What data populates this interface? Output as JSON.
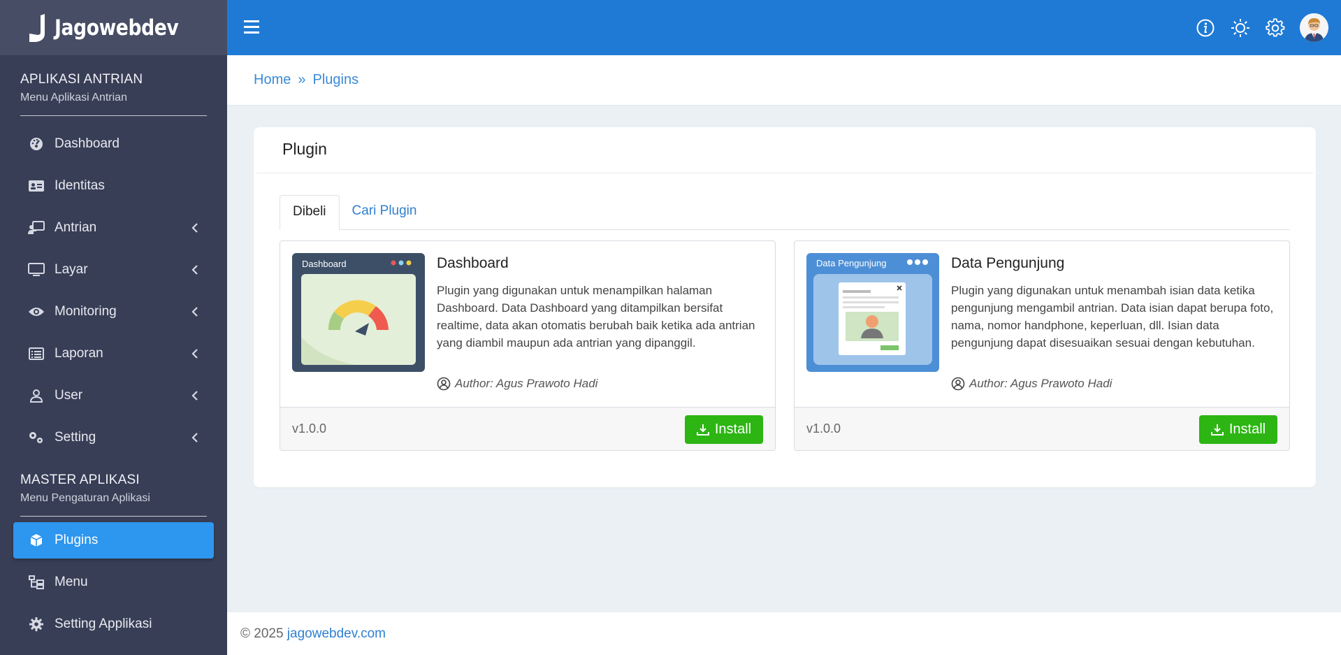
{
  "brand": {
    "name": "Jagowebdev"
  },
  "sidebar": {
    "section1": {
      "title": "APLIKASI ANTRIAN",
      "subtitle": "Menu Aplikasi Antrian"
    },
    "items1": [
      {
        "label": "Dashboard",
        "icon": "dashboard-icon",
        "has_submenu": false
      },
      {
        "label": "Identitas",
        "icon": "id-card-icon",
        "has_submenu": false
      },
      {
        "label": "Antrian",
        "icon": "queue-icon",
        "has_submenu": true
      },
      {
        "label": "Layar",
        "icon": "monitor-icon",
        "has_submenu": true
      },
      {
        "label": "Monitoring",
        "icon": "eye-icon",
        "has_submenu": true
      },
      {
        "label": "Laporan",
        "icon": "report-icon",
        "has_submenu": true
      },
      {
        "label": "User",
        "icon": "user-icon",
        "has_submenu": true
      },
      {
        "label": "Setting",
        "icon": "gears-icon",
        "has_submenu": true
      }
    ],
    "section2": {
      "title": "MASTER APLIKASI",
      "subtitle": "Menu Pengaturan Aplikasi"
    },
    "items2": [
      {
        "label": "Plugins",
        "icon": "cube-icon",
        "active": true
      },
      {
        "label": "Menu",
        "icon": "tree-icon",
        "active": false
      },
      {
        "label": "Setting Applikasi",
        "icon": "gear-icon",
        "active": false
      }
    ]
  },
  "topbar": {
    "icons": [
      "info-icon",
      "sun-icon",
      "gear-icon",
      "avatar"
    ]
  },
  "breadcrumb": {
    "home": "Home",
    "separator": "»",
    "current": "Plugins"
  },
  "card": {
    "title": "Plugin",
    "tabs": [
      {
        "label": "Dibeli",
        "active": true
      },
      {
        "label": "Cari Plugin",
        "active": false
      }
    ],
    "plugins": [
      {
        "thumb_label": "Dashboard",
        "title": "Dashboard",
        "description": "Plugin yang digunakan untuk menampilkan halaman Dashboard. Data Dashboard yang ditampilkan bersifat realtime, data akan otomatis berubah baik ketika ada antrian yang diambil maupun ada antrian yang dipanggil.",
        "author": "Author: Agus Prawoto Hadi",
        "version": "v1.0.0",
        "button": "Install"
      },
      {
        "thumb_label": "Data Pengunjung",
        "title": "Data Pengunjung",
        "description": "Plugin yang digunakan untuk menambah isian data ketika pengunjung mengambil antrian. Data isian dapat berupa foto, nama, nomor handphone, keperluan, dll. Isian data pengunjung dapat disesuaikan sesuai dengan kebutuhan.",
        "author": "Author: Agus Prawoto Hadi",
        "version": "v1.0.0",
        "button": "Install"
      }
    ]
  },
  "footer": {
    "copyright": "© 2025 ",
    "link": "jagowebdev.com"
  },
  "colors": {
    "sidebar": "#383e56",
    "topbar": "#1f7ad5",
    "active_item": "#2d96ee",
    "install_button": "#2cb513",
    "link": "#2f7fd0"
  }
}
